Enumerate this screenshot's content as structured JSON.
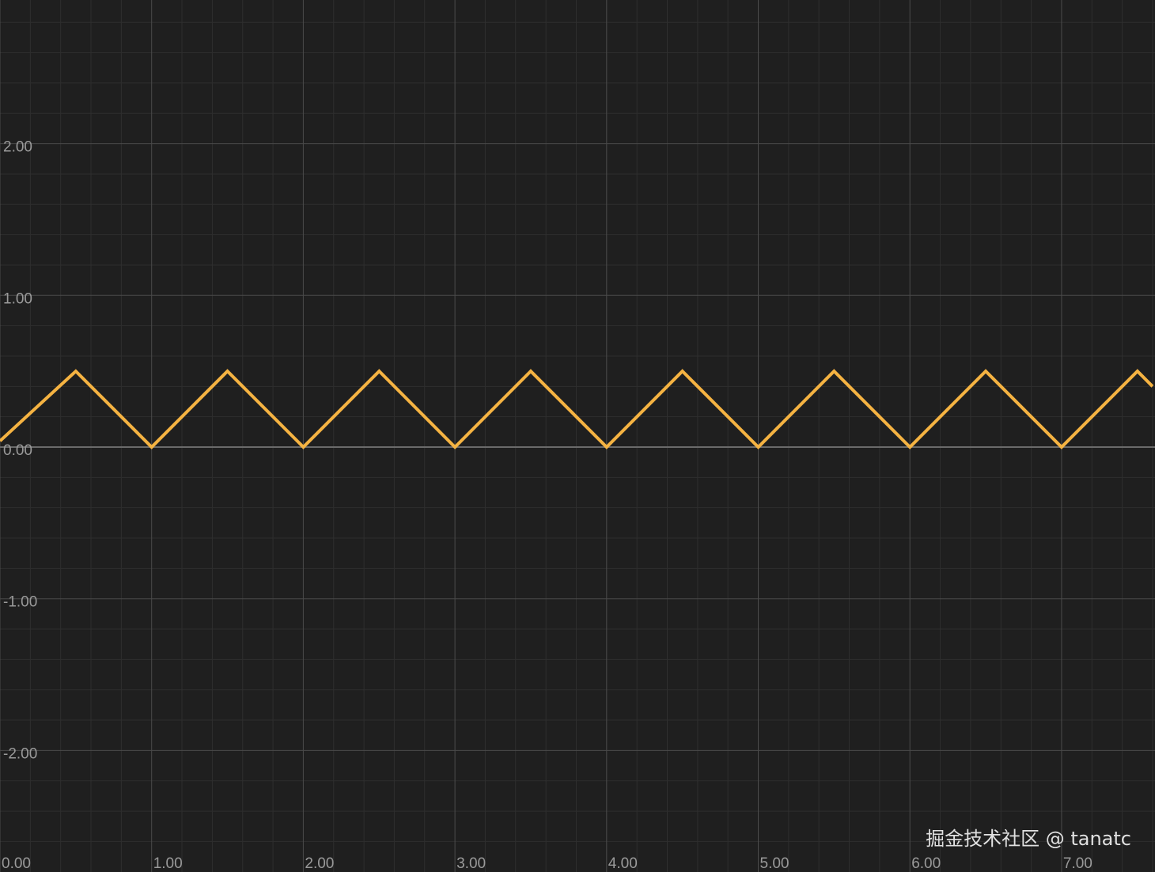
{
  "chart_data": {
    "type": "line",
    "x_ticks": [
      "0.00",
      "1.00",
      "2.00",
      "3.00",
      "4.00",
      "5.00",
      "6.00",
      "7.00"
    ],
    "y_ticks": [
      "2.00",
      "1.00",
      "0.00",
      "-1.00",
      "-2.00"
    ],
    "xlim": [
      0,
      7.6
    ],
    "ylim": [
      -2.7,
      2.93
    ],
    "grid": true,
    "series": [
      {
        "color": "#f5b342",
        "description": "triangle wave, period 1, min 0.00, max 0.50",
        "x": [
          0,
          0.5,
          1,
          1.5,
          2,
          2.5,
          3,
          3.5,
          4,
          4.5,
          5,
          5.5,
          6,
          6.5,
          7,
          7.5,
          7.6
        ],
        "y": [
          0.04,
          0.5,
          0,
          0.5,
          0,
          0.5,
          0,
          0.5,
          0,
          0.5,
          0,
          0.5,
          0,
          0.5,
          0,
          0.5,
          0.4
        ]
      }
    ]
  },
  "colors": {
    "background": "#1f1f1f",
    "major_grid": "#4a4a4a",
    "minor_grid": "#2e2e2e",
    "zero_line": "#6a6a6a",
    "tick_text": "#9a9a9a"
  },
  "watermark": "掘金技术社区 @ tanatc"
}
